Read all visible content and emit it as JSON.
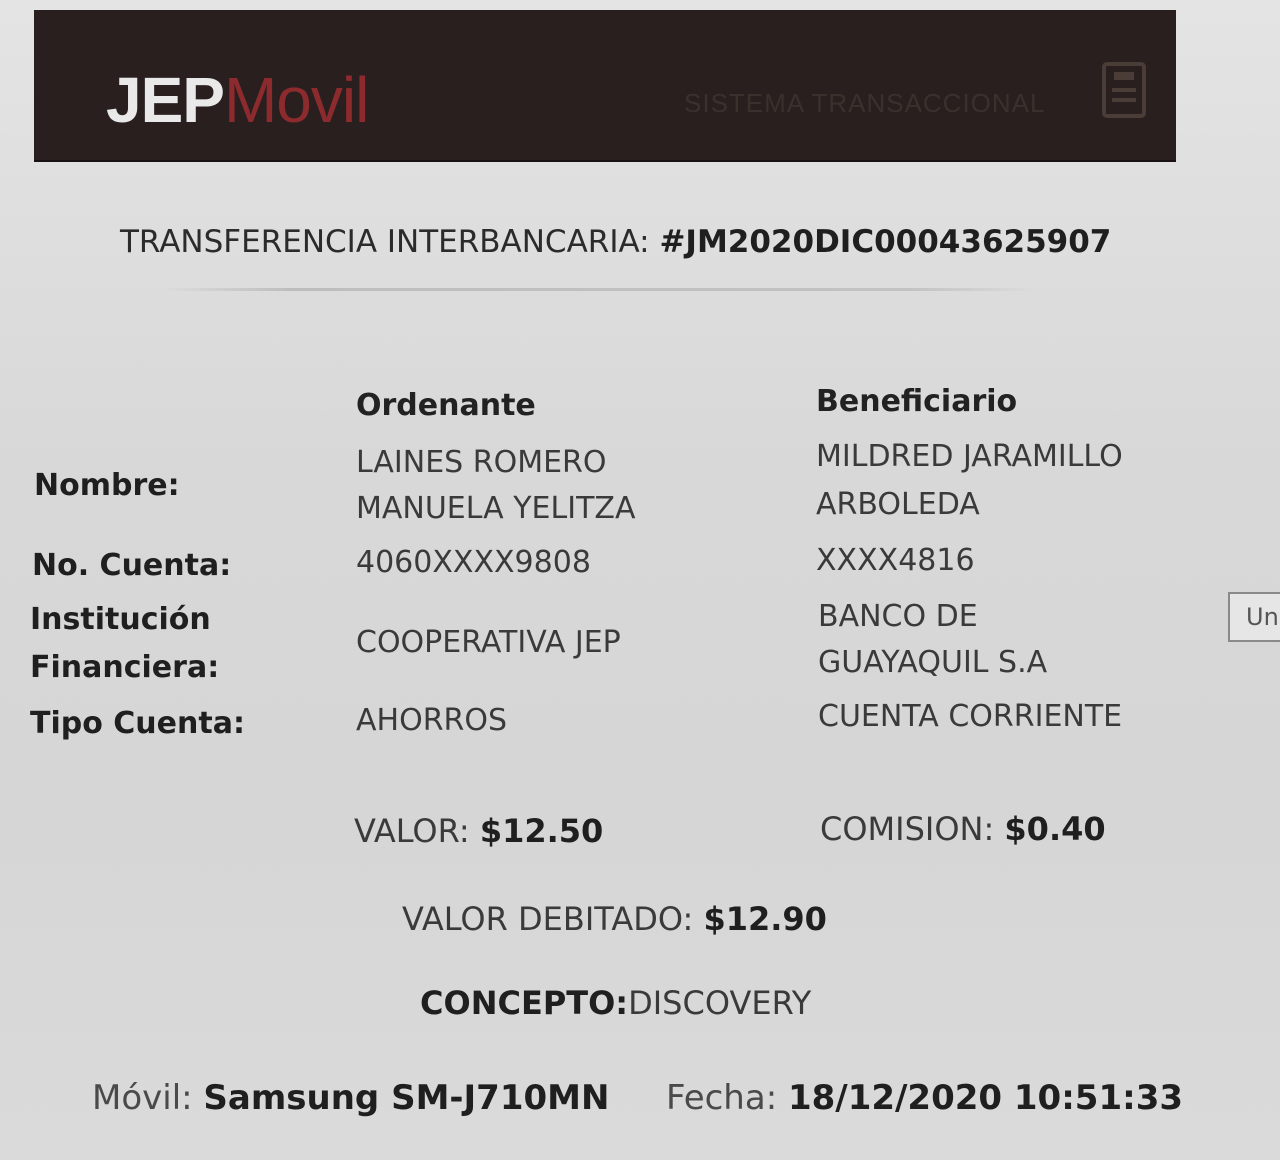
{
  "header": {
    "logo_strong": "JEP",
    "logo_light": "Movil",
    "system_label": "SISTEMA TRANSACCIONAL",
    "icon": "document-icon"
  },
  "transaction": {
    "title_label": "TRANSFERENCIA INTERBANCARIA:",
    "id": "#JM2020DIC00043625907"
  },
  "columns": {
    "ordenante": "Ordenante",
    "beneficiario": "Beneficiario"
  },
  "rows": {
    "nombre": {
      "label": "Nombre:",
      "ordenante_line1": "LAINES ROMERO",
      "ordenante_line2": "MANUELA YELITZA",
      "beneficiario_line1": "MILDRED JARAMILLO",
      "beneficiario_line2": "ARBOLEDA"
    },
    "cuenta": {
      "label": "No. Cuenta:",
      "ordenante": "4060XXXX9808",
      "beneficiario": "XXXX4816"
    },
    "institucion": {
      "label_line1": "Institución",
      "label_line2": "Financiera:",
      "ordenante": "COOPERATIVA JEP",
      "beneficiario_line1": "BANCO DE",
      "beneficiario_line2": "GUAYAQUIL S.A"
    },
    "tipo": {
      "label": "Tipo Cuenta:",
      "ordenante": "AHORROS",
      "beneficiario": "CUENTA CORRIENTE"
    }
  },
  "amounts": {
    "valor_label": "VALOR:",
    "valor": "$12.50",
    "comision_label": "COMISION:",
    "comision": "$0.40",
    "debitado_label": "VALOR DEBITADO:",
    "debitado": "$12.90"
  },
  "concepto": {
    "label": "CONCEPTO:",
    "value": "DISCOVERY"
  },
  "footer": {
    "movil_label": "Móvil:",
    "movil_value": "Samsung SM-J710MN",
    "fecha_label": "Fecha:",
    "fecha_value": "18/12/2020 10:51:33"
  },
  "side_button": {
    "label": "Un"
  },
  "colors": {
    "header_bg": "#2a1f1f",
    "logo_accent": "#8d2a2e",
    "page_bg": "#dcdcdc"
  }
}
